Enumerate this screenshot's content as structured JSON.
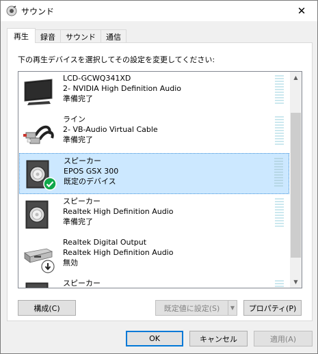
{
  "window": {
    "title": "サウンド",
    "close_label": "✕"
  },
  "tabs": [
    {
      "label": "再生"
    },
    {
      "label": "録音"
    },
    {
      "label": "サウンド"
    },
    {
      "label": "通信"
    }
  ],
  "instruction": "下の再生デバイスを選択してその設定を変更してください:",
  "devices": [
    {
      "name": "LCD-GCWQ341XD",
      "driver": "2- NVIDIA High Definition Audio",
      "status": "準備完了",
      "icon": "monitor-icon",
      "selected": false
    },
    {
      "name": "ライン",
      "driver": "2- VB-Audio Virtual Cable",
      "status": "準備完了",
      "icon": "rca-cable-icon",
      "selected": false
    },
    {
      "name": "スピーカー",
      "driver": "EPOS GSX 300",
      "status": "既定のデバイス",
      "icon": "speaker-icon",
      "selected": true
    },
    {
      "name": "スピーカー",
      "driver": "Realtek High Definition Audio",
      "status": "準備完了",
      "icon": "speaker-icon",
      "selected": false
    },
    {
      "name": "Realtek Digital Output",
      "driver": "Realtek High Definition Audio",
      "status": "無効",
      "icon": "digital-output-icon",
      "selected": false
    },
    {
      "name": "スピーカー",
      "driver": "",
      "status": "",
      "icon": "speaker-icon",
      "selected": false
    }
  ],
  "buttons": {
    "configure": "構成(C)",
    "set_default": "既定値に設定(S)",
    "properties": "プロパティ(P)",
    "ok": "OK",
    "cancel": "キャンセル",
    "apply": "適用(A)"
  },
  "colors": {
    "selection": "#cce8ff",
    "default_check": "#10a84a",
    "accent": "#0078d7"
  }
}
